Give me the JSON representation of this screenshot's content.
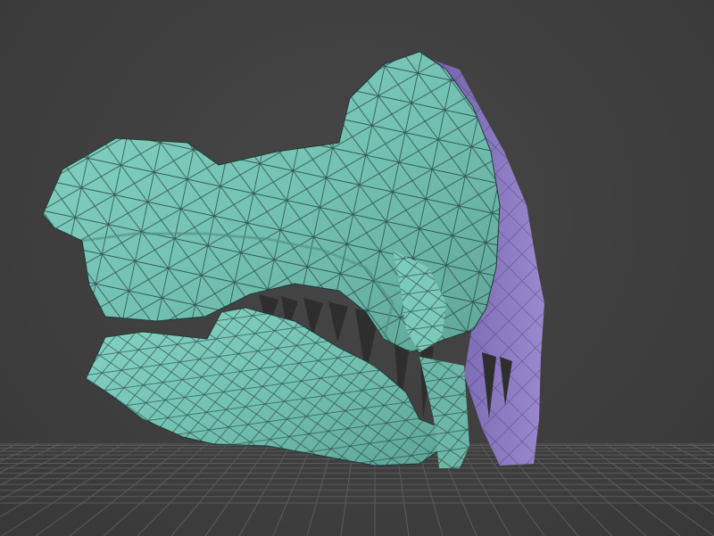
{
  "viewport": {
    "background_color": "#3f3f3f",
    "grid_color": "#5a5a5a",
    "grid_visible": true
  },
  "model": {
    "description_icon": "skull-jaw-mesh",
    "outer_color": "#77c4b6",
    "inner_color": "#8675b8",
    "wireframe_color": "#1f3a36",
    "teeth_color": "#2e2e2e"
  }
}
